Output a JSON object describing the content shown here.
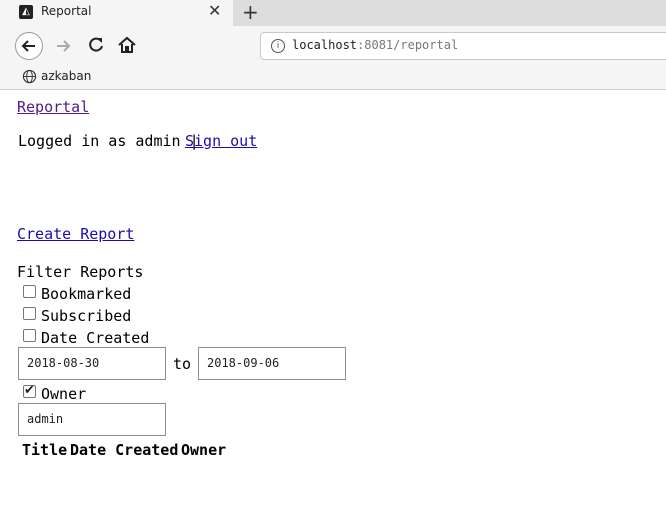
{
  "browser": {
    "tab_title": "Reportal",
    "tab_close": "✕",
    "new_tab": "+",
    "url_host": "localhost",
    "url_path": ":8081/reportal",
    "bookmark": "azkaban"
  },
  "header": {
    "home_link": "Reportal",
    "logged_in_text": "Logged in as admin |",
    "sign_out": "Sign out"
  },
  "create_report": "Create Report",
  "filter": {
    "title": "Filter Reports",
    "bookmarked": {
      "label": "Bookmarked",
      "checked": false
    },
    "subscribed": {
      "label": "Subscribed",
      "checked": false
    },
    "date_created": {
      "label": "Date Created",
      "checked": false
    },
    "date_from": "2018-08-30",
    "date_to_label": "to",
    "date_to": "2018-09-06",
    "owner": {
      "label": "Owner",
      "checked": true
    },
    "owner_value": "admin"
  },
  "table": {
    "columns": [
      "Title",
      "Date Created",
      "Owner"
    ]
  }
}
